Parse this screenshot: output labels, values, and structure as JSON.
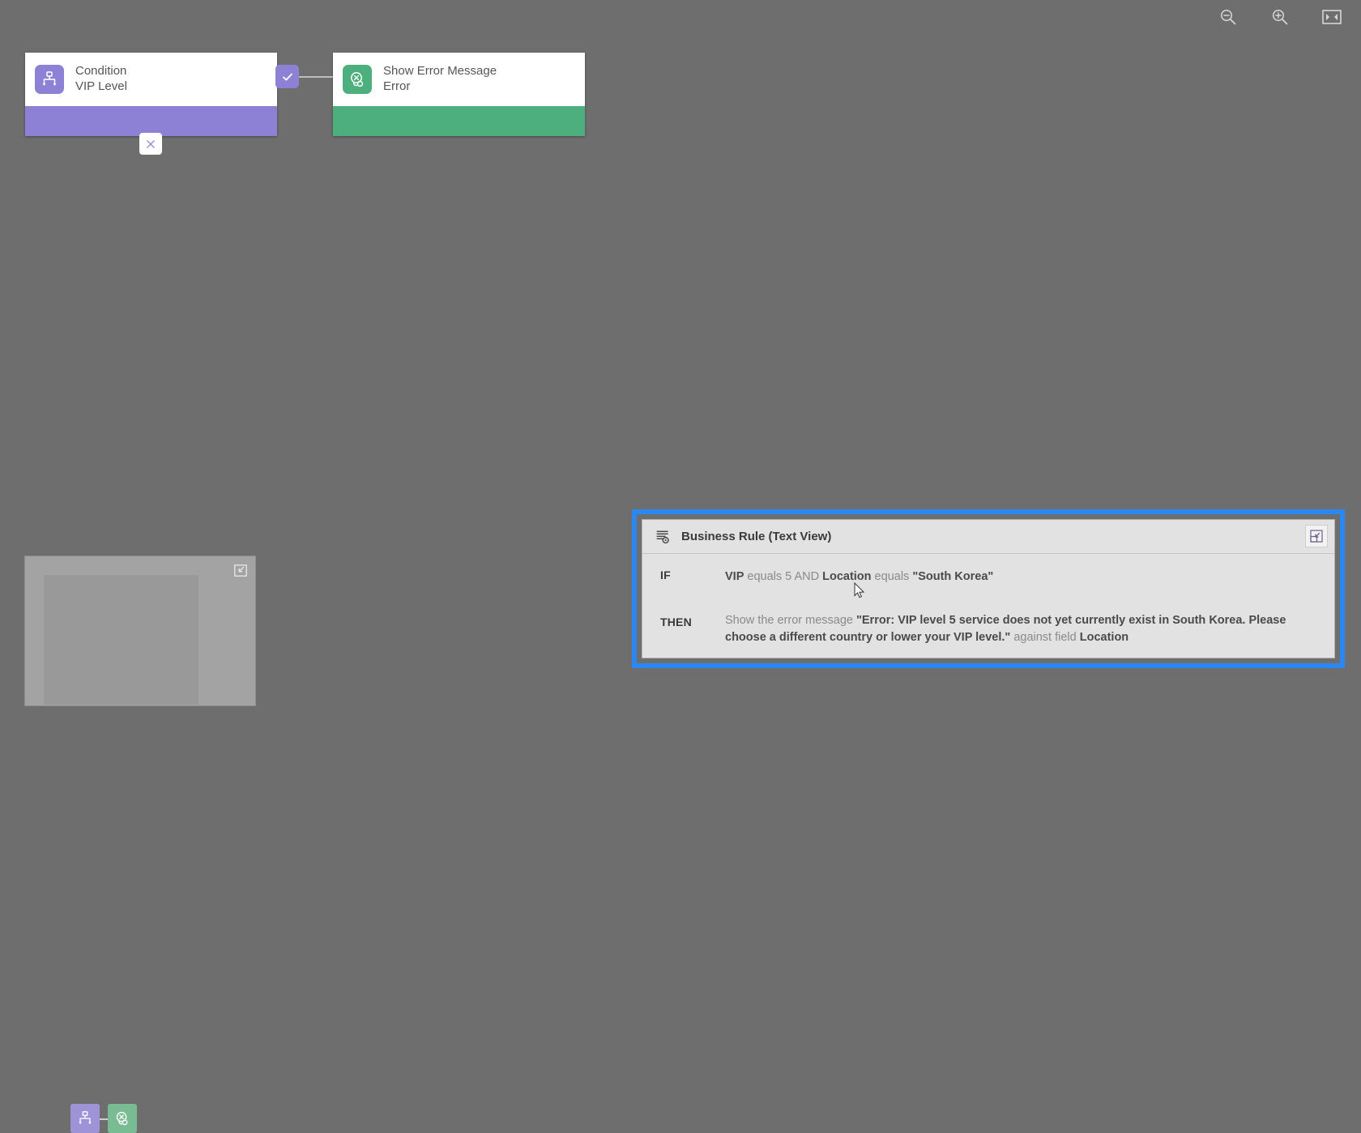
{
  "toolbar": {
    "buttons": [
      {
        "name": "zoom-out-icon",
        "label": "Zoom Out"
      },
      {
        "name": "zoom-in-icon",
        "label": "Zoom In"
      },
      {
        "name": "fit-to-screen-icon",
        "label": "Fit to Screen"
      }
    ]
  },
  "canvas": {
    "nodes": [
      {
        "id": "condition",
        "title": "Condition",
        "subtitle": "VIP Level",
        "icon": "condition-branch-icon",
        "color": "#8c81d4"
      },
      {
        "id": "error",
        "title": "Show Error Message",
        "subtitle": "Error",
        "icon": "show-error-message-icon",
        "color": "#4caf7d"
      }
    ],
    "branches": {
      "true_badge": "check-icon",
      "false_badge": "close-icon"
    }
  },
  "minimap": {
    "collapse_icon": "collapse-minimap-icon",
    "nodes": [
      {
        "id": "condition",
        "color": "#9e93d6",
        "icon": "condition-branch-icon"
      },
      {
        "id": "error",
        "color": "#79bb93",
        "icon": "show-error-message-icon"
      }
    ]
  },
  "rule_panel": {
    "title": "Business Rule (Text View)",
    "header_icon": "business-rule-icon",
    "dock_icon": "restore-panel-icon",
    "selection_color": "#2b88f0",
    "if": {
      "label": "IF",
      "parts": [
        {
          "text": "VIP",
          "bold": true
        },
        {
          "text": " equals 5 AND ",
          "bold": false
        },
        {
          "text": "Location",
          "bold": true
        },
        {
          "text": " equals ",
          "bold": false
        },
        {
          "text": "\"South Korea\"",
          "bold": true
        }
      ]
    },
    "then": {
      "label": "THEN",
      "parts": [
        {
          "text": "Show the error message ",
          "bold": false
        },
        {
          "text": "\"Error: VIP level 5 service does not yet currently exist in South Korea. Please choose a different country or lower your VIP level.\"",
          "bold": true
        },
        {
          "text": " against field ",
          "bold": false
        },
        {
          "text": "Location",
          "bold": true
        }
      ]
    }
  }
}
